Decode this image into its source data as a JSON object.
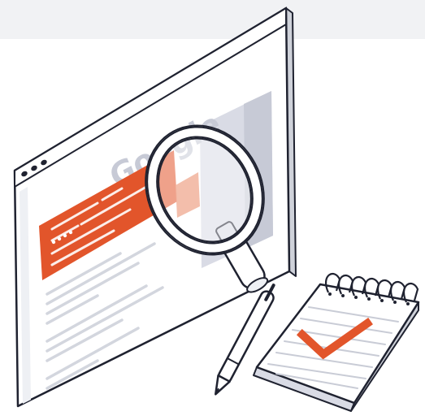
{
  "illustration": {
    "logo_text": "Google",
    "colors": {
      "accent": "#e2552b",
      "accent_soft": "#f2b7a2",
      "panel_gray": "#d9dbe5",
      "logo_gray": "#c7cad6",
      "outline": "#1f2230",
      "paper": "#ffffff",
      "page_shade": "#eef0f4",
      "top_band": "#f1f2f4"
    },
    "icons": {
      "window": "browser-window-icon",
      "magnifier": "magnifying-glass-icon",
      "pen": "pen-icon",
      "notepad": "spiral-notepad-icon",
      "check": "checkmark-icon"
    }
  }
}
